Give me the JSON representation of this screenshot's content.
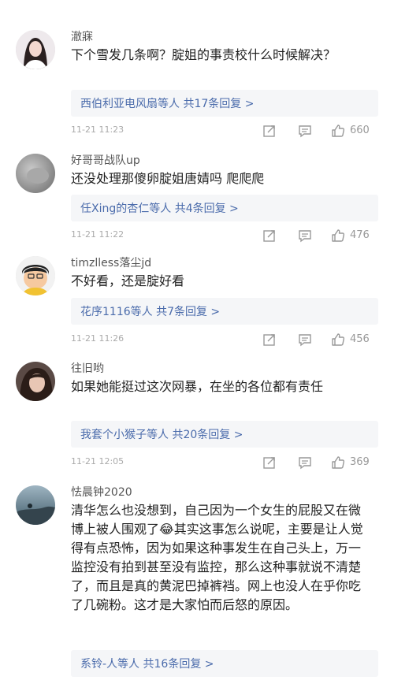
{
  "comments": [
    {
      "username": "澈寐",
      "text": "下个雪发几条啊？腚姐的事责校什么时候解决？",
      "reply_summary": "西伯利亚电风扇等人 共17条回复 >",
      "time": "11-21 11:23",
      "likes": "660",
      "avatar_icon": "avatar-woman-icon"
    },
    {
      "username": "好哥哥战队up",
      "text": "还没处理那傻卵腚姐唐婧吗  爬爬爬",
      "reply_summary": "任Xing的杏仁等人 共4条回复 >",
      "time": "11-21 11:22",
      "likes": "476",
      "avatar_icon": "avatar-gray-icon"
    },
    {
      "username": "timzlless落尘jd",
      "text": "不好看，还是腚好看",
      "reply_summary": "花序1116等人 共7条回复 >",
      "time": "11-21 11:26",
      "likes": "456",
      "avatar_icon": "avatar-cartoon-boy-icon"
    },
    {
      "username": "往旧哟",
      "text": "如果她能挺过这次网暴，在坐的各位都有责任",
      "reply_summary": "我套个小猴子等人 共20条回复 >",
      "time": "11-21 12:05",
      "likes": "369",
      "avatar_icon": "avatar-girl-icon"
    },
    {
      "username": "怯晨钟2020",
      "text": "清华怎么也没想到，自己因为一个女生的屁股又在微博上被人围观了😂其实这事怎么说呢，主要是让人觉得有点恐怖，因为如果这种事发生在自己头上，万一监控没有拍到甚至没有监控，那么这种事就说不清楚了，而且是真的黄泥巴掉裤裆。网上也没人在乎你吃了几碗粉。这才是大家怕而后怒的原因。",
      "reply_summary": "系铃-人等人 共16条回复 >",
      "avatar_icon": "avatar-landscape-icon"
    }
  ],
  "colors": {
    "link": "#4a6bab",
    "reply_bg": "#f5f6f8",
    "meta_text": "#aaaaaa"
  }
}
